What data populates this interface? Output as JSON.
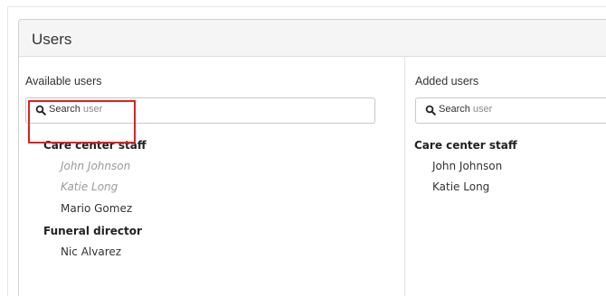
{
  "panel": {
    "title": "Users"
  },
  "available": {
    "label": "Available users",
    "search": {
      "prefix": "Search",
      "placeholder": "user"
    },
    "groups": [
      {
        "heading": "Care center staff",
        "users": [
          {
            "name": "John Johnson",
            "state": "disabled"
          },
          {
            "name": "Katie Long",
            "state": "disabled"
          },
          {
            "name": "Mario Gomez",
            "state": "normal"
          }
        ]
      },
      {
        "heading": "Funeral director",
        "users": [
          {
            "name": "Nic Alvarez",
            "state": "normal"
          }
        ]
      }
    ]
  },
  "added": {
    "label": "Added users",
    "search": {
      "prefix": "Search",
      "placeholder": "user"
    },
    "groups": [
      {
        "heading": "Care center staff",
        "users": [
          {
            "name": "John Johnson",
            "state": "normal"
          },
          {
            "name": "Katie Long",
            "state": "normal"
          }
        ]
      }
    ]
  },
  "colors": {
    "highlight": "#e02020",
    "disabled_text": "#9a9a9a"
  }
}
